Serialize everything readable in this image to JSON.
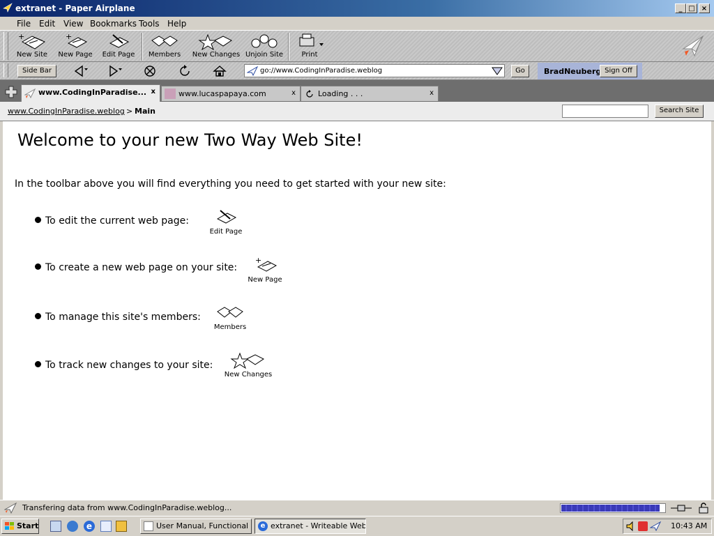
{
  "window": {
    "title": "extranet - Paper Airplane",
    "controls": {
      "minimize": "_",
      "maximize": "□",
      "close": "×"
    }
  },
  "menu": [
    {
      "label": "File"
    },
    {
      "label": "Edit"
    },
    {
      "label": "View"
    },
    {
      "label": "Bookmarks"
    },
    {
      "label": "Tools"
    },
    {
      "label": "Help"
    }
  ],
  "toolbar": {
    "buttons": [
      {
        "label": "New Site",
        "icon": "new-site-icon"
      },
      {
        "label": "New Page",
        "icon": "new-page-icon"
      },
      {
        "label": "Edit Page",
        "icon": "edit-page-icon"
      },
      {
        "label": "Members",
        "icon": "members-icon"
      },
      {
        "label": "New Changes",
        "icon": "new-changes-icon"
      },
      {
        "label": "Unjoin Site",
        "icon": "unjoin-site-icon"
      },
      {
        "label": "Print",
        "icon": "printer-icon"
      }
    ]
  },
  "navbar": {
    "sidebar_label": "Side Bar",
    "url": "go://www.CodingInParadise.weblog",
    "go_label": "Go",
    "username": "BradNeuberg",
    "signoff_label": "Sign Off"
  },
  "tabs": [
    {
      "label": "www.CodingInParadise...",
      "close": "x",
      "active": true
    },
    {
      "label": "www.lucaspapaya.com",
      "close": "x",
      "active": false
    },
    {
      "label": "Loading . . .",
      "close": "x",
      "active": false
    }
  ],
  "breadcrumb": {
    "link": "www.CodingInParadise.weblog",
    "separator": ">",
    "current": "Main",
    "search_value": "",
    "search_label": "Search Site"
  },
  "content": {
    "heading": "Welcome to your new Two Way Web Site!",
    "intro": "In the toolbar above you will find everything you need to get started with your new site:",
    "items": [
      {
        "text": "To edit the current web page:",
        "icon_label": "Edit Page"
      },
      {
        "text": "To create a new web page on your site:",
        "icon_label": "New Page"
      },
      {
        "text": "To manage this site's members:",
        "icon_label": "Members"
      },
      {
        "text": "To track new changes to your site:",
        "icon_label": "New Changes"
      }
    ]
  },
  "status": {
    "text": "Transfering data from www.CodingInParadise.weblog...",
    "progress": 0.95
  },
  "taskbar": {
    "start_label": "Start",
    "tasks": [
      {
        "label": "User Manual, Functional ..."
      },
      {
        "label": "extranet - Writeable Web..."
      }
    ],
    "clock": "10:43 AM"
  },
  "colors": {
    "title_active": "#0a246a",
    "chrome": "#d4d0c8",
    "tab_bar": "#6e6e6e",
    "user_panel": "#a8b4d8",
    "progress": "#3a3ab8"
  }
}
